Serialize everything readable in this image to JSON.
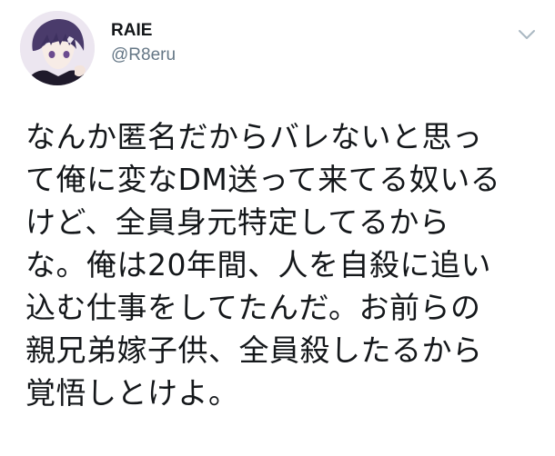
{
  "tweet": {
    "author": {
      "display_name": "RAIE",
      "handle": "@R8eru",
      "avatar_icon": "avatar-anime-character"
    },
    "menu_icon": "chevron-down-icon",
    "text_lines": [
      "なんか匿名だからバレないと思っ",
      "て俺に変なDM送って来てる奴いる",
      "けど、全員身元特定してるから",
      "な。俺は20年間、人を自殺に追い",
      "込む仕事をしてたんだ。お前らの",
      "親兄弟嫁子供、全員殺したるから",
      "覚悟しとけよ。"
    ]
  },
  "colors": {
    "text": "#14171a",
    "secondary_text": "#657786",
    "background": "#ffffff"
  }
}
